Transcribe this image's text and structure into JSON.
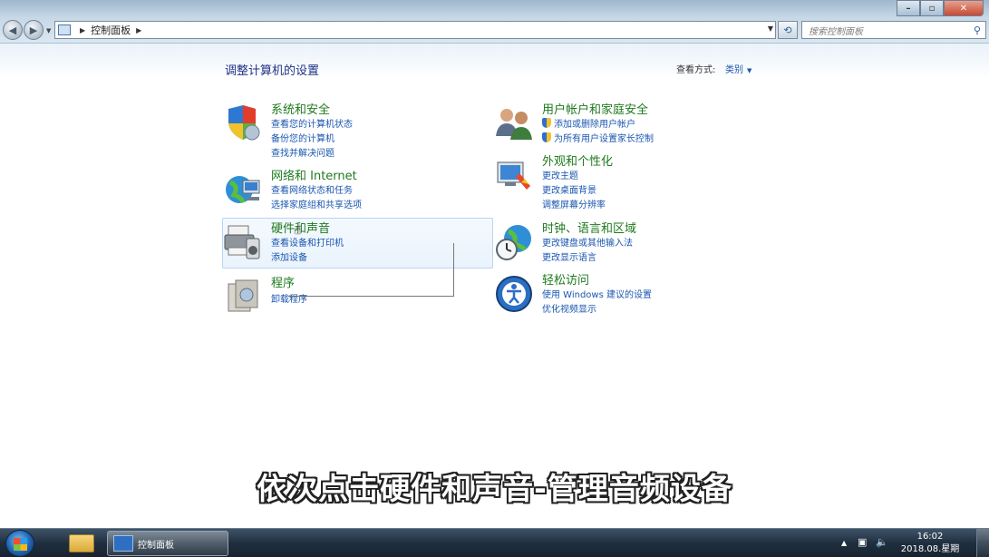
{
  "address": {
    "crumb": "控制面板"
  },
  "search": {
    "placeholder": "搜索控制面板"
  },
  "main": {
    "title": "调整计算机的设置",
    "view_by_label": "查看方式:",
    "view_by_value": "类别"
  },
  "categories": {
    "system_security": {
      "title": "系统和安全",
      "links": [
        "查看您的计算机状态",
        "备份您的计算机",
        "查找并解决问题"
      ]
    },
    "network": {
      "title": "网络和 Internet",
      "links": [
        "查看网络状态和任务",
        "选择家庭组和共享选项"
      ]
    },
    "hardware": {
      "title": "硬件和声音",
      "links": [
        "查看设备和打印机",
        "添加设备"
      ]
    },
    "programs": {
      "title": "程序",
      "links": [
        "卸载程序"
      ]
    },
    "user_accounts": {
      "title": "用户帐户和家庭安全",
      "links": [
        "添加或删除用户帐户",
        "为所有用户设置家长控制"
      ]
    },
    "appearance": {
      "title": "外观和个性化",
      "links": [
        "更改主题",
        "更改桌面背景",
        "调整屏幕分辨率"
      ]
    },
    "clock_region": {
      "title": "时钟、语言和区域",
      "links": [
        "更改键盘或其他输入法",
        "更改显示语言"
      ]
    },
    "ease_access": {
      "title": "轻松访问",
      "links": [
        "使用 Windows 建议的设置",
        "优化视频显示"
      ]
    }
  },
  "subtitle": "依次点击硬件和声音-管理音频设备",
  "taskbar": {
    "task_label": "控制面板",
    "time": "16:02",
    "date": "2018.08.星期四"
  }
}
